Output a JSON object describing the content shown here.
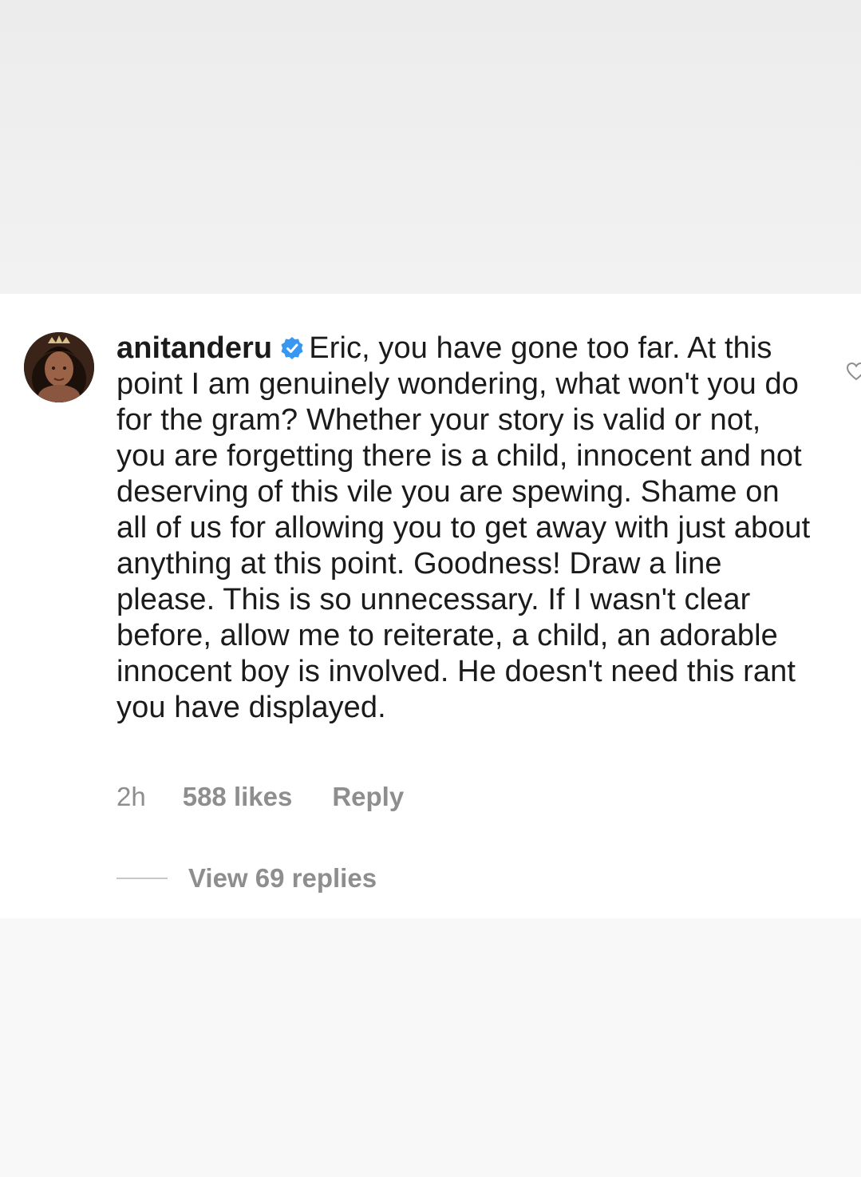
{
  "comment": {
    "username": "anitanderu",
    "verified": true,
    "text": "Eric, you have gone too far. At this point I am genuinely wondering, what won't you do for the gram? Whether your story is valid or not, you are forgetting there is a child, innocent and not deserving of this vile you are spewing. Shame on all of us for allowing you to get away with just about anything at this point. Goodness! Draw a line please. This is so unnecessary. If I wasn't clear before, allow me to reiterate, a child, an adorable innocent boy is involved. He doesn't need this rant you have displayed.",
    "timestamp": "2h",
    "likes": "588 likes",
    "reply_label": "Reply",
    "view_replies": "View 69 replies"
  },
  "colors": {
    "text": "#1b1b1b",
    "muted": "#8e8e8e",
    "verified": "#3897f0",
    "card_bg": "#ffffff",
    "page_bg": "#f7f7f7"
  },
  "icons": {
    "verified": "verified-badge-icon",
    "like": "heart-icon"
  }
}
